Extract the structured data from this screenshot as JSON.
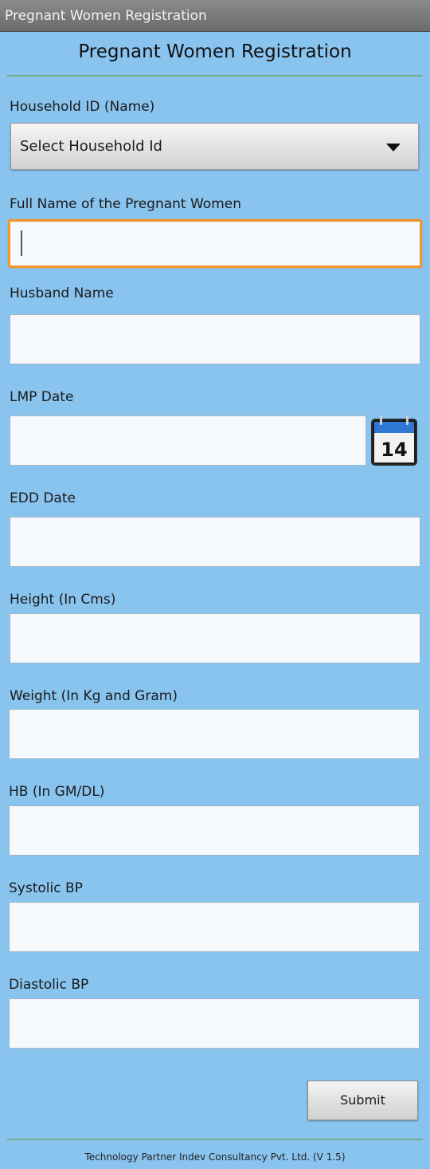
{
  "app": {
    "title": "Pregnant Women Registration"
  },
  "form": {
    "heading": "Pregnant Women Registration",
    "household": {
      "label": "Household ID (Name)",
      "selected": "Select Household Id"
    },
    "full_name": {
      "label": "Full Name of the  Pregnant Women",
      "value": ""
    },
    "husband_name": {
      "label": "Husband Name",
      "value": ""
    },
    "lmp_date": {
      "label": "LMP Date",
      "value": "",
      "calendar_day": "14"
    },
    "edd_date": {
      "label": "EDD Date",
      "value": ""
    },
    "height": {
      "label": "Height (In Cms)",
      "value": ""
    },
    "weight": {
      "label": "Weight (In Kg and Gram)",
      "value": ""
    },
    "hb": {
      "label": "HB (In GM/DL)",
      "value": ""
    },
    "systolic": {
      "label": "Systolic BP",
      "value": ""
    },
    "diastolic": {
      "label": "Diastolic BP",
      "value": ""
    },
    "submit_label": "Submit"
  },
  "footer": {
    "text": "Technology Partner Indev Consultancy Pvt. Ltd. (V 1.5)"
  },
  "colors": {
    "background": "#89c4ef",
    "focus_border": "#f0962c",
    "divider": "#6fae86",
    "title_bar": "#7a7a7a"
  }
}
